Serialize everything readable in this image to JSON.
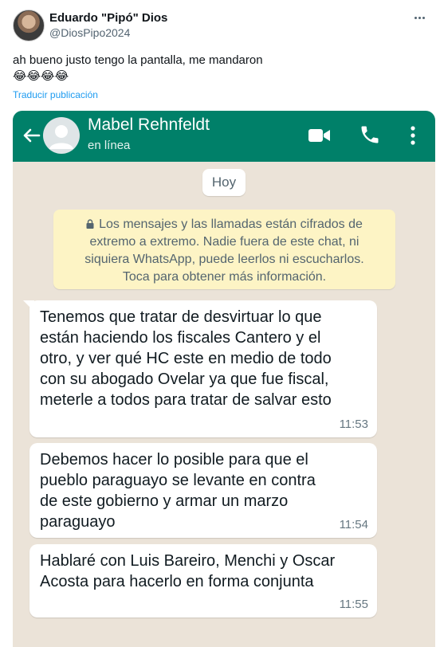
{
  "tweet": {
    "author_name": "Eduardo \"Pipó\" Dios",
    "author_handle": "@DiosPipo2024",
    "text": "ah bueno justo tengo la pantalla, me mandaron\n😂😂😂😂",
    "translate_label": "Traducir publicación"
  },
  "chat": {
    "contact_name": "Mabel Rehnfeldt",
    "contact_status": "en línea",
    "date_chip": "Hoy",
    "encryption_notice": [
      "Los mensajes y las llamadas están cifrados de",
      "extremo a extremo. Nadie fuera de este chat, ni",
      "siquiera WhatsApp, puede leerlos ni escucharlos.",
      "Toca para obtener más información."
    ],
    "messages": [
      {
        "lines": [
          "Tenemos que tratar de desvirtuar lo que",
          "están haciendo los fiscales Cantero y el",
          "otro, y ver qué HC este en medio de todo",
          "con su abogado Ovelar ya que fue fiscal,",
          "meterle a todos para tratar de salvar esto"
        ],
        "time": "11:53"
      },
      {
        "lines": [
          "Debemos hacer lo posible para que el",
          "pueblo paraguayo se levante en contra",
          "de este gobierno y armar un marzo",
          "paraguayo"
        ],
        "time": "11:54"
      },
      {
        "lines": [
          "Hablaré con Luis Bareiro, Menchi y Oscar",
          "Acosta para hacerlo en forma conjunta"
        ],
        "time": "11:55"
      }
    ]
  },
  "colors": {
    "whatsapp_header": "#008069",
    "chat_background": "#ebe3d8",
    "notice_background": "#fdf4c5",
    "link": "#1d9bf0"
  },
  "icons": {
    "tweet_more": "more-horizontal-icon",
    "back": "arrow-left-icon",
    "contact_avatar": "default-avatar-icon",
    "video": "video-camera-icon",
    "call": "phone-icon",
    "menu": "more-vertical-icon",
    "notice": "lock-icon"
  }
}
